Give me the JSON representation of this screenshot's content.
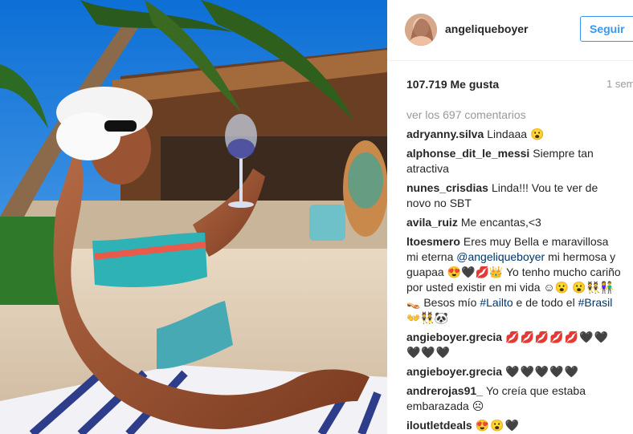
{
  "post": {
    "username": "angeliqueboyer",
    "follow_label": "Seguir",
    "likes": "107.719 Me gusta",
    "time": "1 sem",
    "view_comments": "ver los 697 comentarios"
  },
  "comments": [
    {
      "user": "adryanny.silva",
      "text": "Lindaaa 😮"
    },
    {
      "user": "alphonse_dit_le_messi",
      "text": "Siempre tan atractiva"
    },
    {
      "user": "nunes_crisdias",
      "text": "Linda!!! Vou te ver de novo no SBT"
    },
    {
      "user": "avila_ruiz",
      "text": "Me encantas,<3"
    },
    {
      "user": "ltoesmero",
      "p1": "Eres muy Bella e maravillosa mi eterna ",
      "mention": "@angeliqueboyer",
      "p2": " mi hermosa y guapaa 😍🖤💋👑 Yo tenho mucho cariño por usted existir en mi vida ☺😮 😮👯👫👡 Besos mío ",
      "tag1": "#Lailto",
      "p3": " e de todo el ",
      "tag2": "#Brasil",
      "p4": " 👐👯🐼"
    },
    {
      "user": "angieboyer.grecia",
      "text": "💋💋💋💋💋🖤🖤🖤🖤🖤"
    },
    {
      "user": "angieboyer.grecia",
      "text": "🖤🖤🖤🖤🖤"
    },
    {
      "user": "andrerojas91_",
      "text": "Yo creía que estaba embarazada ☹"
    },
    {
      "user": "iloutletdeals",
      "text": "😍😮🖤"
    }
  ],
  "icons": {
    "avatar": "profile-photo",
    "post_image": "beach-photo"
  },
  "colors": {
    "accent": "#3897f0",
    "link": "#003569",
    "muted": "#999999"
  }
}
